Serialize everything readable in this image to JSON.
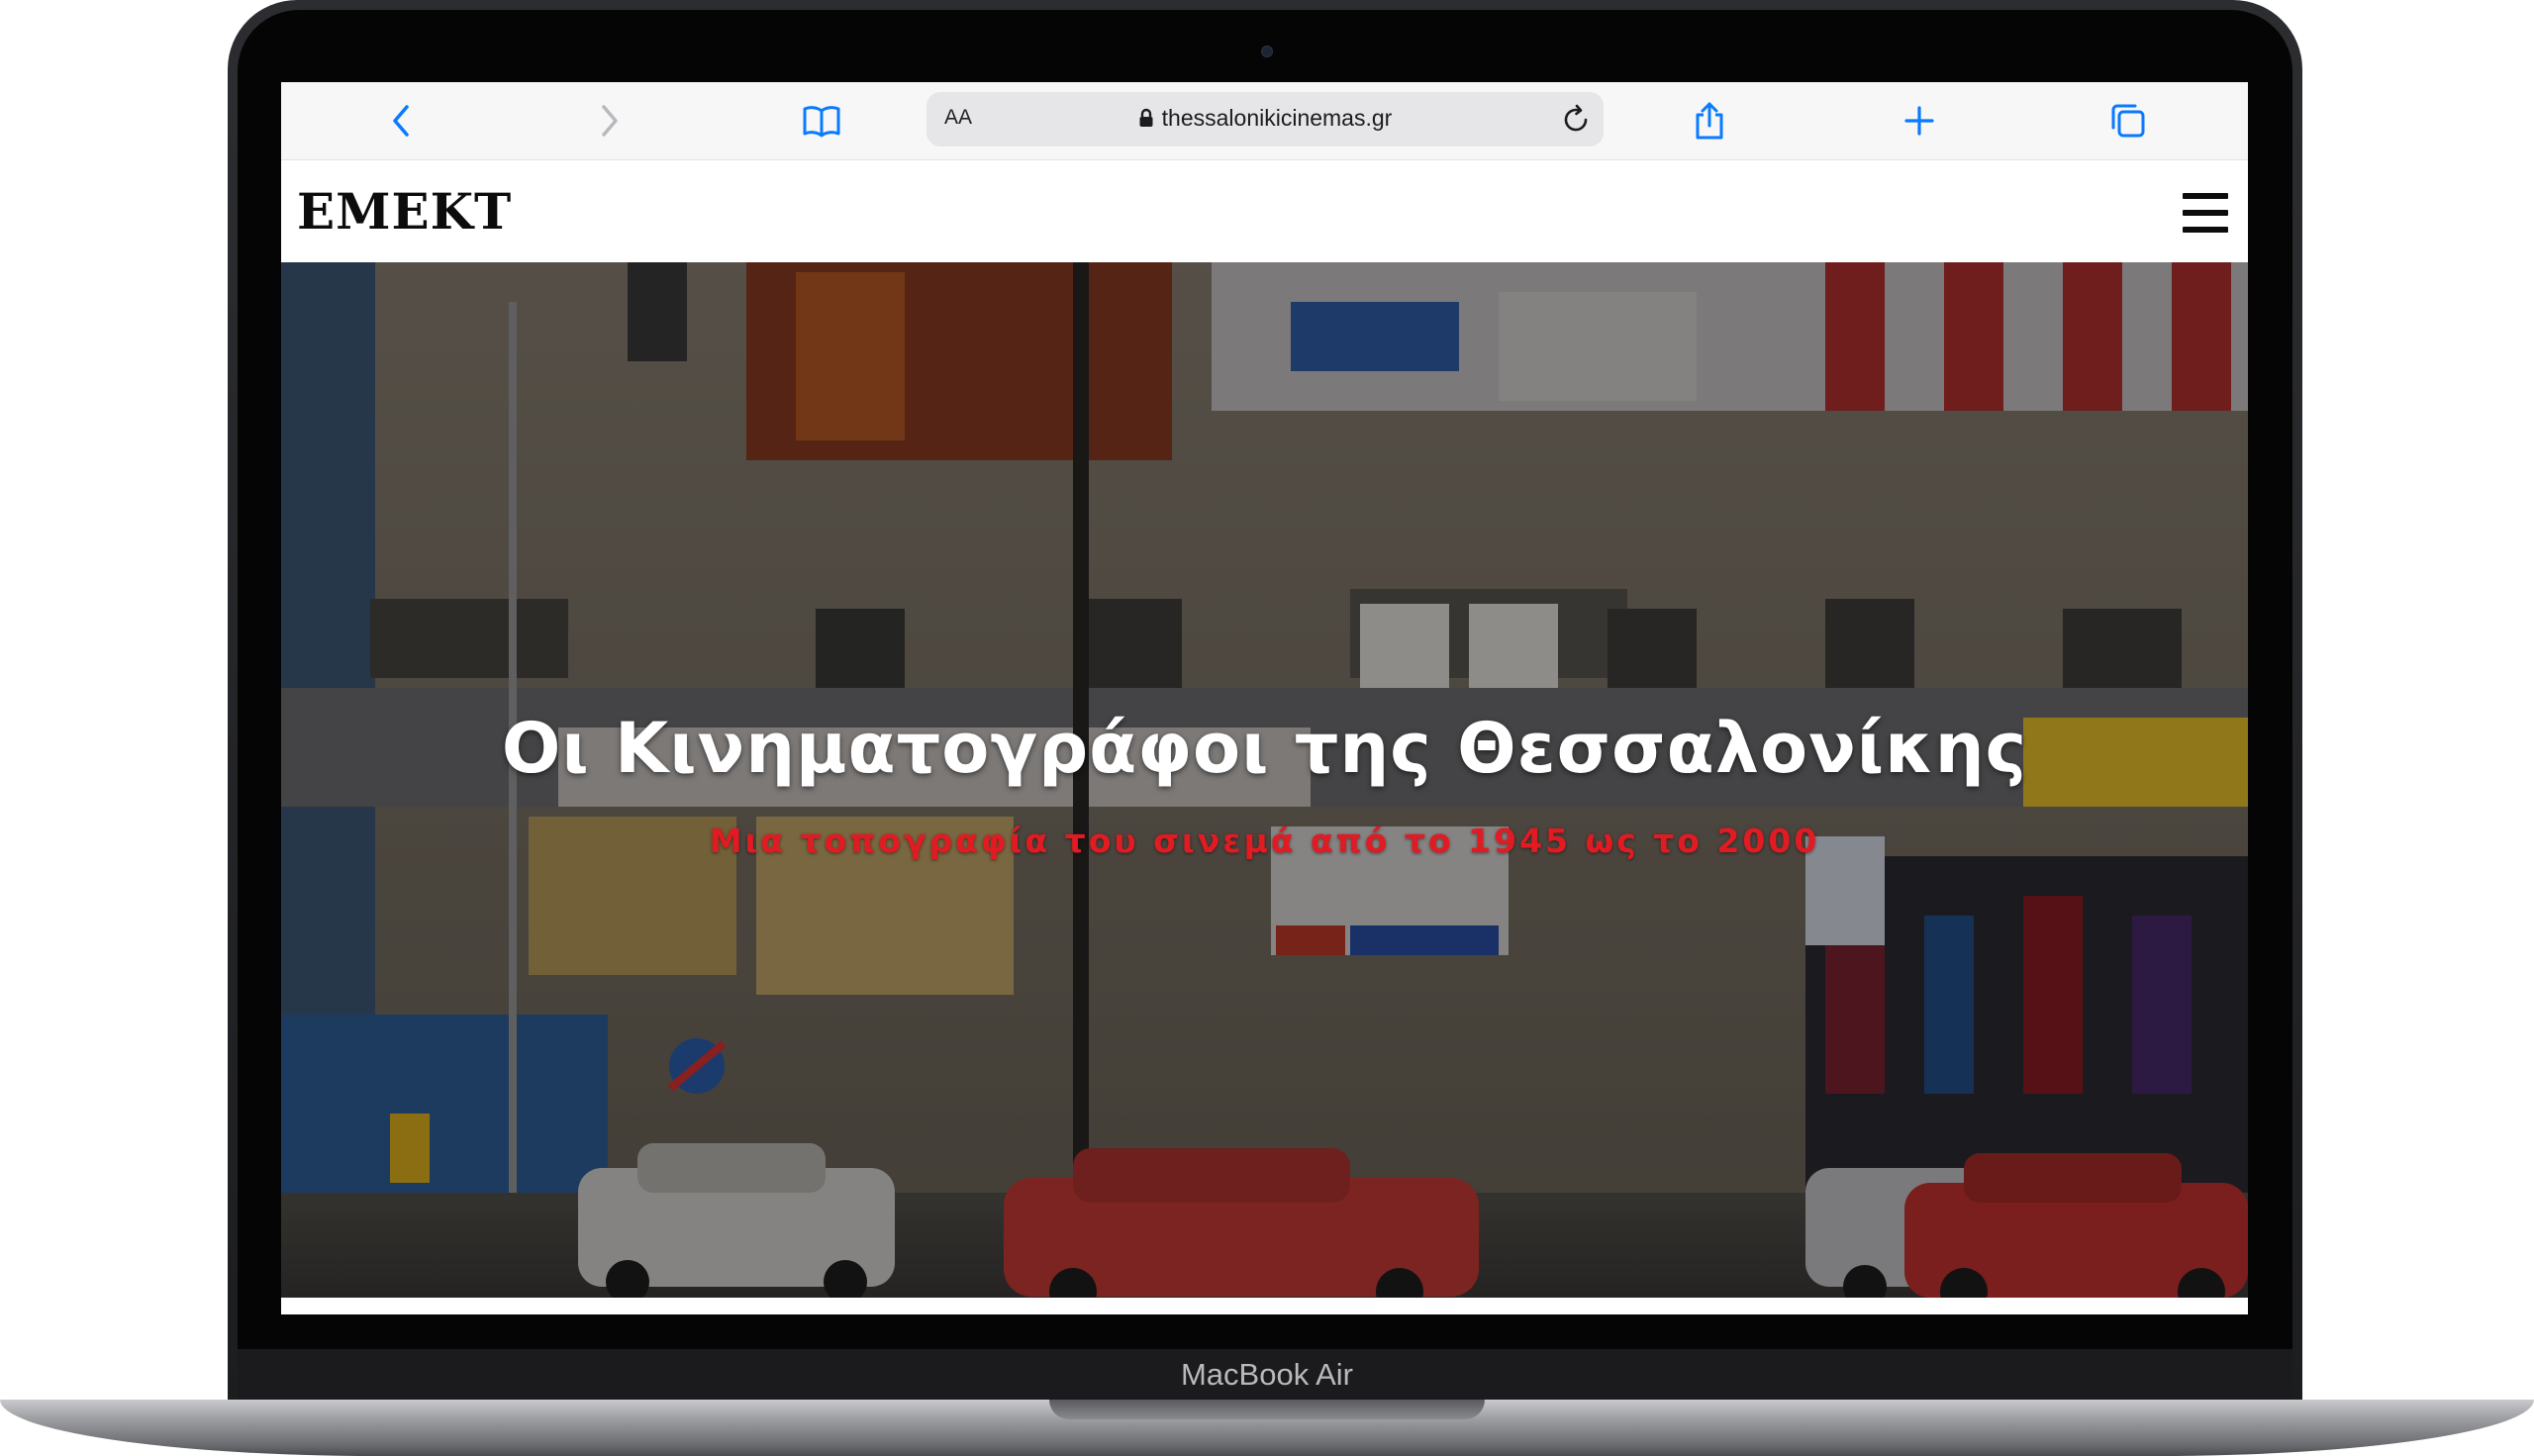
{
  "device": {
    "model_label": "MacBook Air"
  },
  "browser": {
    "text_size_label": "AA",
    "url": "thessalonikicinemas.gr",
    "icons": {
      "back": "chevron-left-icon",
      "forward": "chevron-right-icon",
      "bookmarks": "book-icon",
      "lock": "lock-icon",
      "reload": "reload-icon",
      "share": "share-icon",
      "new_tab": "plus-icon",
      "tabs": "tabs-icon"
    },
    "accent_color": "#0a7aff"
  },
  "site": {
    "logo": "ΕΜΕΚΤ",
    "menu_icon": "hamburger-menu-icon"
  },
  "hero": {
    "title": "Οι Κινηματογράφοι της Θεσσαλονίκης",
    "subtitle": "Μια τοπογραφία του σινεμά από το 1945 ως το 2000",
    "title_color": "#ffffff",
    "subtitle_color": "#e21b23",
    "image_description_icon": "street-photo-image"
  }
}
